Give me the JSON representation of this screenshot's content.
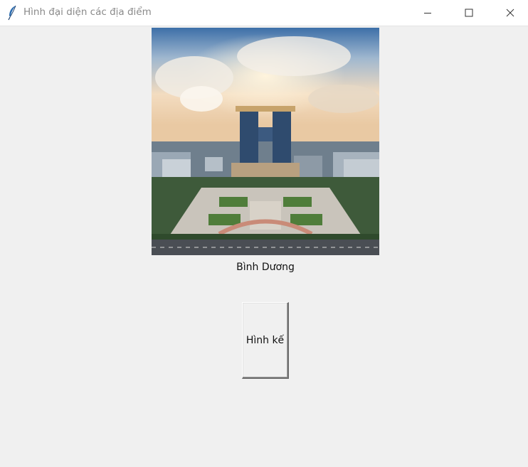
{
  "window": {
    "title": "Hình đại diện các địa điểm",
    "icon": "feather-icon",
    "controls": [
      "minimize-icon",
      "maximize-icon",
      "close-icon"
    ]
  },
  "photo": {
    "subject": "Bình Dương",
    "caption": "Bình Dương"
  },
  "next_button": {
    "label": "Hình kế"
  }
}
